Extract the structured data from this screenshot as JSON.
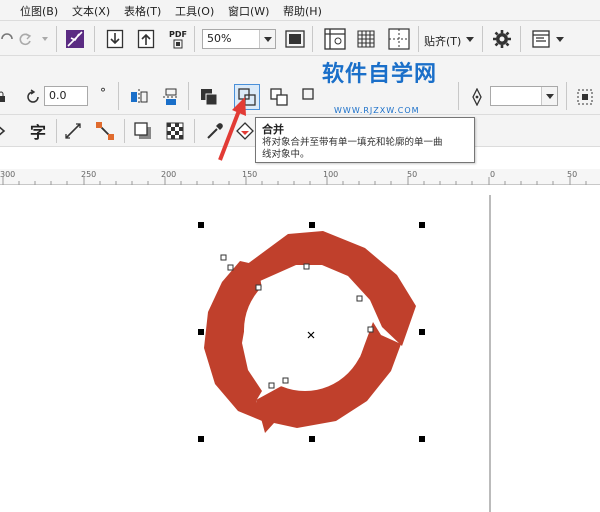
{
  "menu": [
    "位图(B)",
    "文本(X)",
    "表格(T)",
    "工具(O)",
    "窗口(W)",
    "帮助(H)"
  ],
  "toolbar1": {
    "pdf_label": "PDF",
    "zoom_value": "50%",
    "snap_label": "贴齐(T)"
  },
  "toolbar2": {
    "rotation_value": "0.0",
    "rotation_unit": "°"
  },
  "toolbar3": {
    "text_tool_label": "字"
  },
  "tooltip": {
    "title": "合并",
    "line1": "将对象合并至带有单一填充和轮廓的单一曲",
    "line2": "线对象中。"
  },
  "watermark": {
    "main": "软件自学网",
    "sub": "WWW.RJZXW.COM"
  },
  "ruler": {
    "labels": [
      "300",
      "250",
      "200",
      "150",
      "100",
      "50",
      "0",
      "50"
    ]
  },
  "colors": {
    "arrow_fill": "#c0402c",
    "accent_blue": "#1a6fc9",
    "pointer_red": "#e23b35"
  }
}
